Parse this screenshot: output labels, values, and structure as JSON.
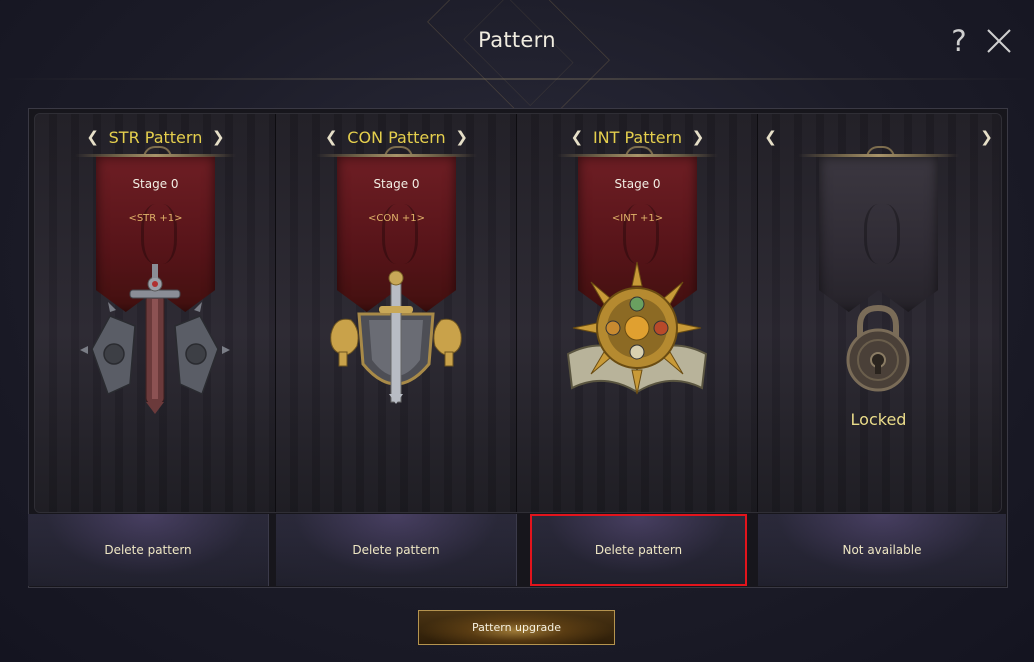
{
  "window": {
    "title": "Pattern",
    "help_icon": "?"
  },
  "cards": [
    {
      "title": "STR Pattern",
      "stage": "Stage 0",
      "bonus": "<STR +1>",
      "emblem": "sword-emblem"
    },
    {
      "title": "CON Pattern",
      "stage": "Stage 0",
      "bonus": "<CON +1>",
      "emblem": "shield-emblem"
    },
    {
      "title": "INT Pattern",
      "stage": "Stage 0",
      "bonus": "<INT +1>",
      "emblem": "sun-book-emblem"
    },
    {
      "title": "",
      "status": "Locked",
      "emblem": "padlock-emblem"
    }
  ],
  "arrows": {
    "left": "❮",
    "right": "❯"
  },
  "actions": [
    "Delete pattern",
    "Delete pattern",
    "Delete pattern",
    "Not available"
  ],
  "upgrade_button": "Pattern upgrade",
  "colors": {
    "title_gold": "#e5cf4d",
    "highlight_red": "#e3141c",
    "banner_red": "#6e1e24"
  }
}
